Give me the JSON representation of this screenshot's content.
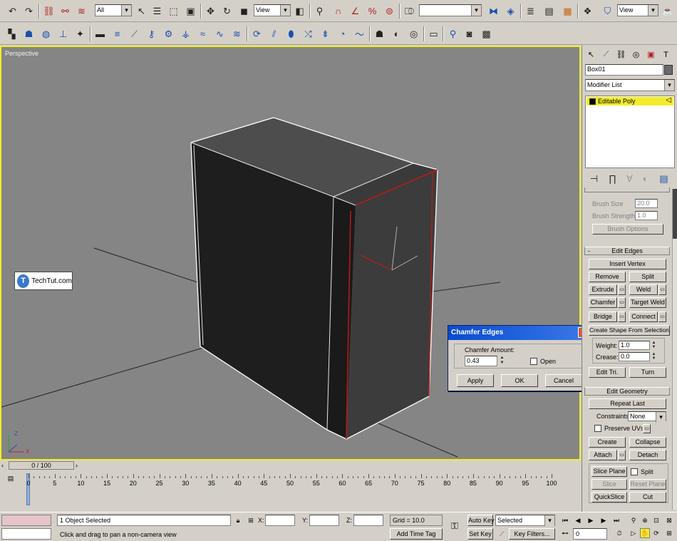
{
  "toolbar_main": {
    "selection_filter": "All",
    "ref_coord": "View",
    "named_selection": "",
    "view_dropdown": "View"
  },
  "viewport": {
    "label": "Perspective",
    "watermark": "TechTut.com",
    "watermark_logo": "T",
    "axis_z": "Z",
    "axis_x": "X",
    "colors": {
      "viewport_bg": "#858585",
      "active_border": "#f3ec2c",
      "selected_edge": "#c01818"
    }
  },
  "chamfer_dialog": {
    "title": "Chamfer Edges",
    "amount_label": "Chamfer Amount:",
    "amount_value": "0.43",
    "open_label": "Open",
    "apply_label": "Apply",
    "ok_label": "OK",
    "cancel_label": "Cancel"
  },
  "command_panel": {
    "object_name": "Box01",
    "modifier_list": "Modifier List",
    "stack_item": "Editable Poly",
    "brush_size_label": "Brush Size",
    "brush_size_value": "20.0",
    "brush_strength_label": "Brush Strength",
    "brush_strength_value": "1.0",
    "brush_options": "Brush Options",
    "edit_edges_title": "Edit Edges",
    "edit_edges_toggle": "-",
    "insert_vertex": "Insert Vertex",
    "remove": "Remove",
    "split": "Split",
    "extrude": "Extrude",
    "weld": "Weld",
    "chamfer": "Chamfer",
    "target_weld": "Target Weld",
    "bridge": "Bridge",
    "connect": "Connect",
    "create_shape": "Create Shape From Selection",
    "weight_label": "Weight:",
    "weight_value": "1.0",
    "crease_label": "Crease:",
    "crease_value": "0.0",
    "edit_tri": "Edit Tri.",
    "turn": "Turn",
    "edit_geometry_title": "Edit Geometry",
    "repeat_last": "Repeat Last",
    "constraints_label": "Constraints:",
    "constraints_value": "None",
    "preserve_uvs": "Preserve UVs",
    "create": "Create",
    "collapse": "Collapse",
    "attach": "Attach",
    "detach": "Detach",
    "slice_plane": "Slice Plane",
    "split_check": "Split",
    "slice": "Slice",
    "reset_plane": "Reset Plane",
    "quickslice": "QuickSlice",
    "cut": "Cut"
  },
  "timeline": {
    "slider_label": "0 / 100",
    "ticks": [
      "0",
      "5",
      "10",
      "15",
      "20",
      "25",
      "30",
      "35",
      "40",
      "45",
      "50",
      "55",
      "60",
      "65",
      "70",
      "75",
      "80",
      "85",
      "90",
      "95",
      "100"
    ]
  },
  "status_bar": {
    "selection_info": "1 Object Selected",
    "prompt": "Click and drag to pan a non-camera view",
    "x_label": "X:",
    "y_label": "Y:",
    "z_label": "Z:",
    "grid": "Grid = 10.0",
    "add_time_tag": "Add Time Tag",
    "auto_key": "Auto Key",
    "set_key": "Set Key",
    "selected": "Selected",
    "key_filters": "Key Filters...",
    "current_frame": "0"
  }
}
